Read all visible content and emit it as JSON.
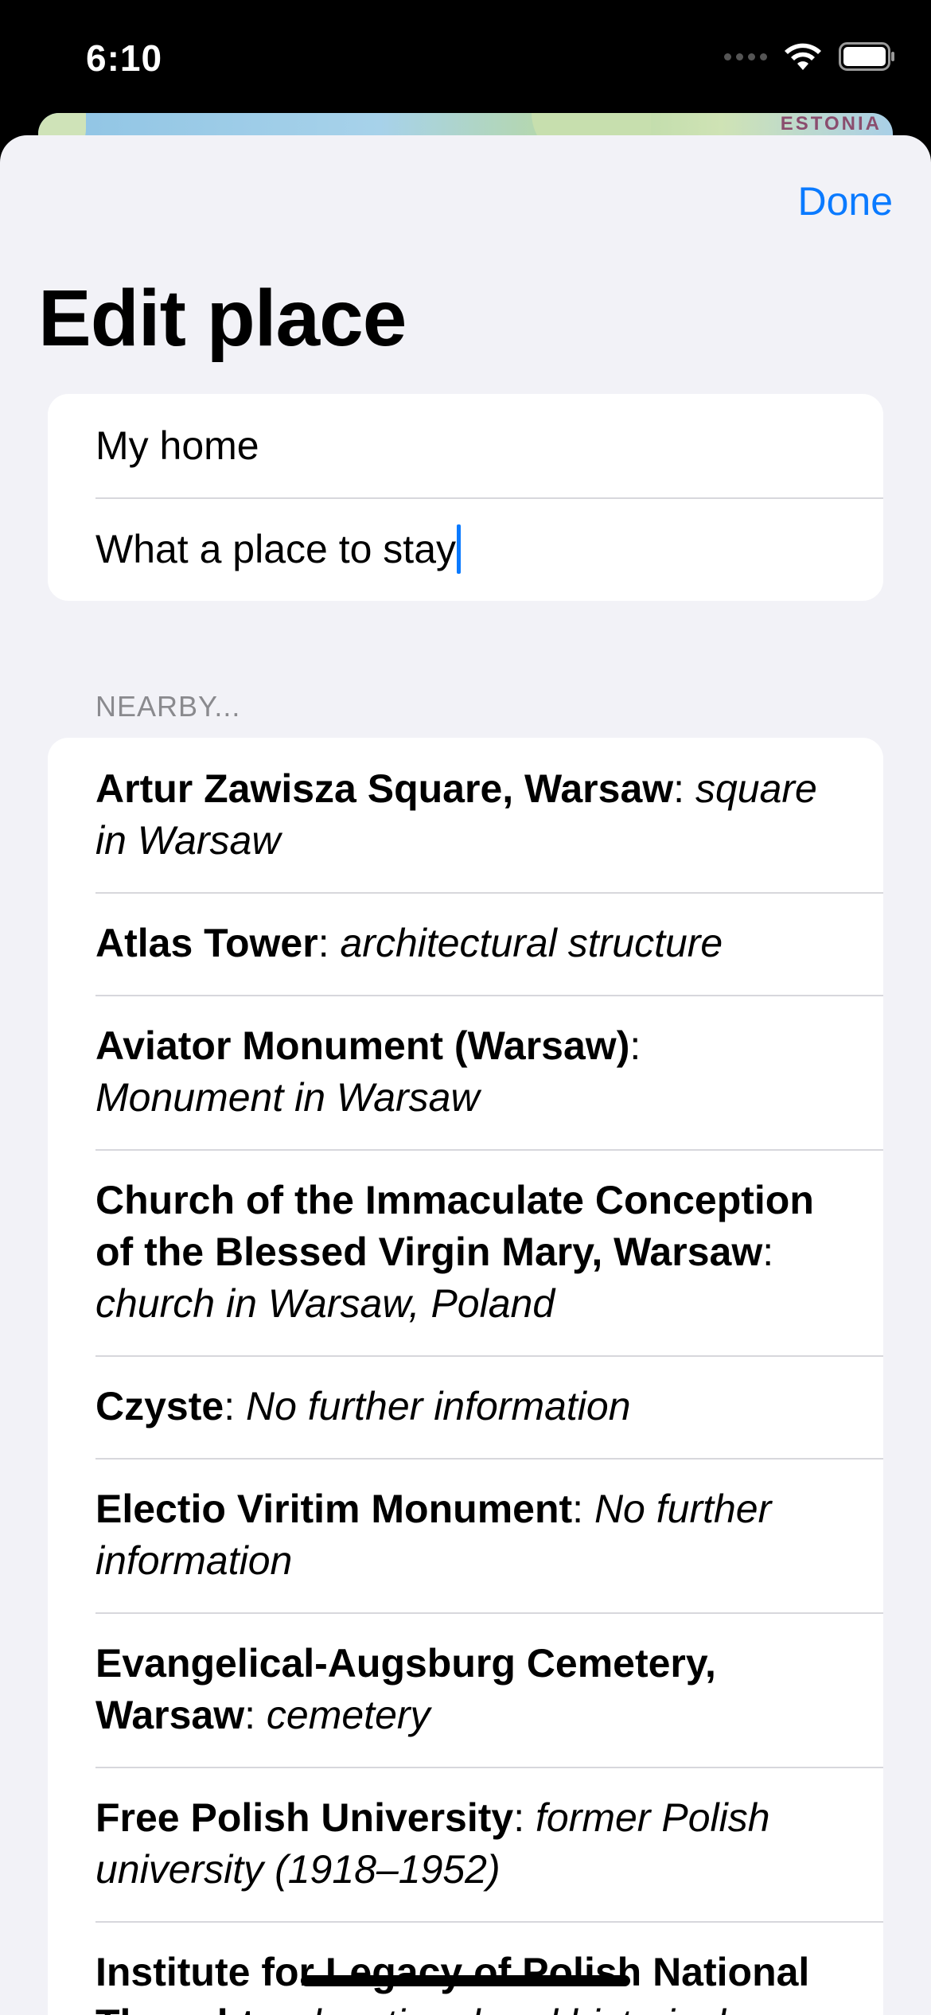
{
  "status_bar": {
    "time": "6:10"
  },
  "map": {
    "label": "ESTONIA"
  },
  "header": {
    "done_label": "Done",
    "title": "Edit place"
  },
  "form": {
    "name_value": "My home",
    "description_value": "What a place to stay"
  },
  "nearby": {
    "section_title": "NEARBY...",
    "items": [
      {
        "name": "Artur Zawisza Square, Warsaw",
        "description": "square in Warsaw"
      },
      {
        "name": "Atlas Tower",
        "description": "architectural structure"
      },
      {
        "name": "Aviator Monument (Warsaw)",
        "description": "Monument in Warsaw"
      },
      {
        "name": "Church of the Immaculate Conception of the Blessed Virgin Mary, Warsaw",
        "description": "church in Warsaw, Poland"
      },
      {
        "name": "Czyste",
        "description": "No further information"
      },
      {
        "name": "Electio Viritim Monument",
        "description": "No further information"
      },
      {
        "name": "Evangelical-Augsburg Cemetery, Warsaw",
        "description": "cemetery"
      },
      {
        "name": "Free Polish University",
        "description": "former Polish university (1918–1952)"
      },
      {
        "name": "Institute for Legacy of Polish National Thought",
        "description": "educational and historical"
      }
    ]
  },
  "icons": {
    "signal": "cellular-signal-icon",
    "wifi": "wifi-icon",
    "battery": "battery-icon"
  }
}
